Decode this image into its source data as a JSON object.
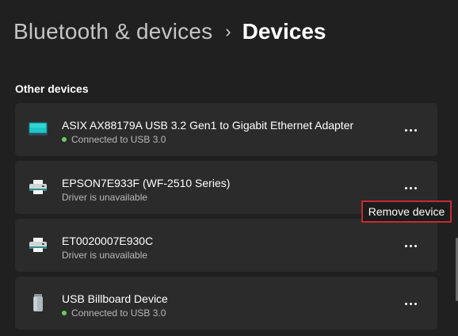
{
  "header": {
    "parent_label": "Bluetooth & devices",
    "separator": "›",
    "current_label": "Devices"
  },
  "section": {
    "title": "Other devices"
  },
  "devices": [
    {
      "name": "ASIX AX88179A USB 3.2 Gen1 to Gigabit Ethernet Adapter",
      "status": "Connected to USB 3.0",
      "icon": "monitor-icon",
      "connected": true
    },
    {
      "name": "EPSON7E933F (WF-2510 Series)",
      "status": "Driver is unavailable",
      "icon": "printer-icon",
      "connected": false
    },
    {
      "name": "ET0020007E930C",
      "status": "Driver is unavailable",
      "icon": "printer-icon",
      "connected": false
    },
    {
      "name": "USB Billboard Device",
      "status": "Connected to USB 3.0",
      "icon": "usb-drive-icon",
      "connected": true
    }
  ],
  "context_menu": {
    "remove_label": "Remove device"
  },
  "colors": {
    "background": "#202020",
    "card": "#2b2b2b",
    "status_connected": "#6ccb5f",
    "highlight_border": "#c42b32"
  }
}
